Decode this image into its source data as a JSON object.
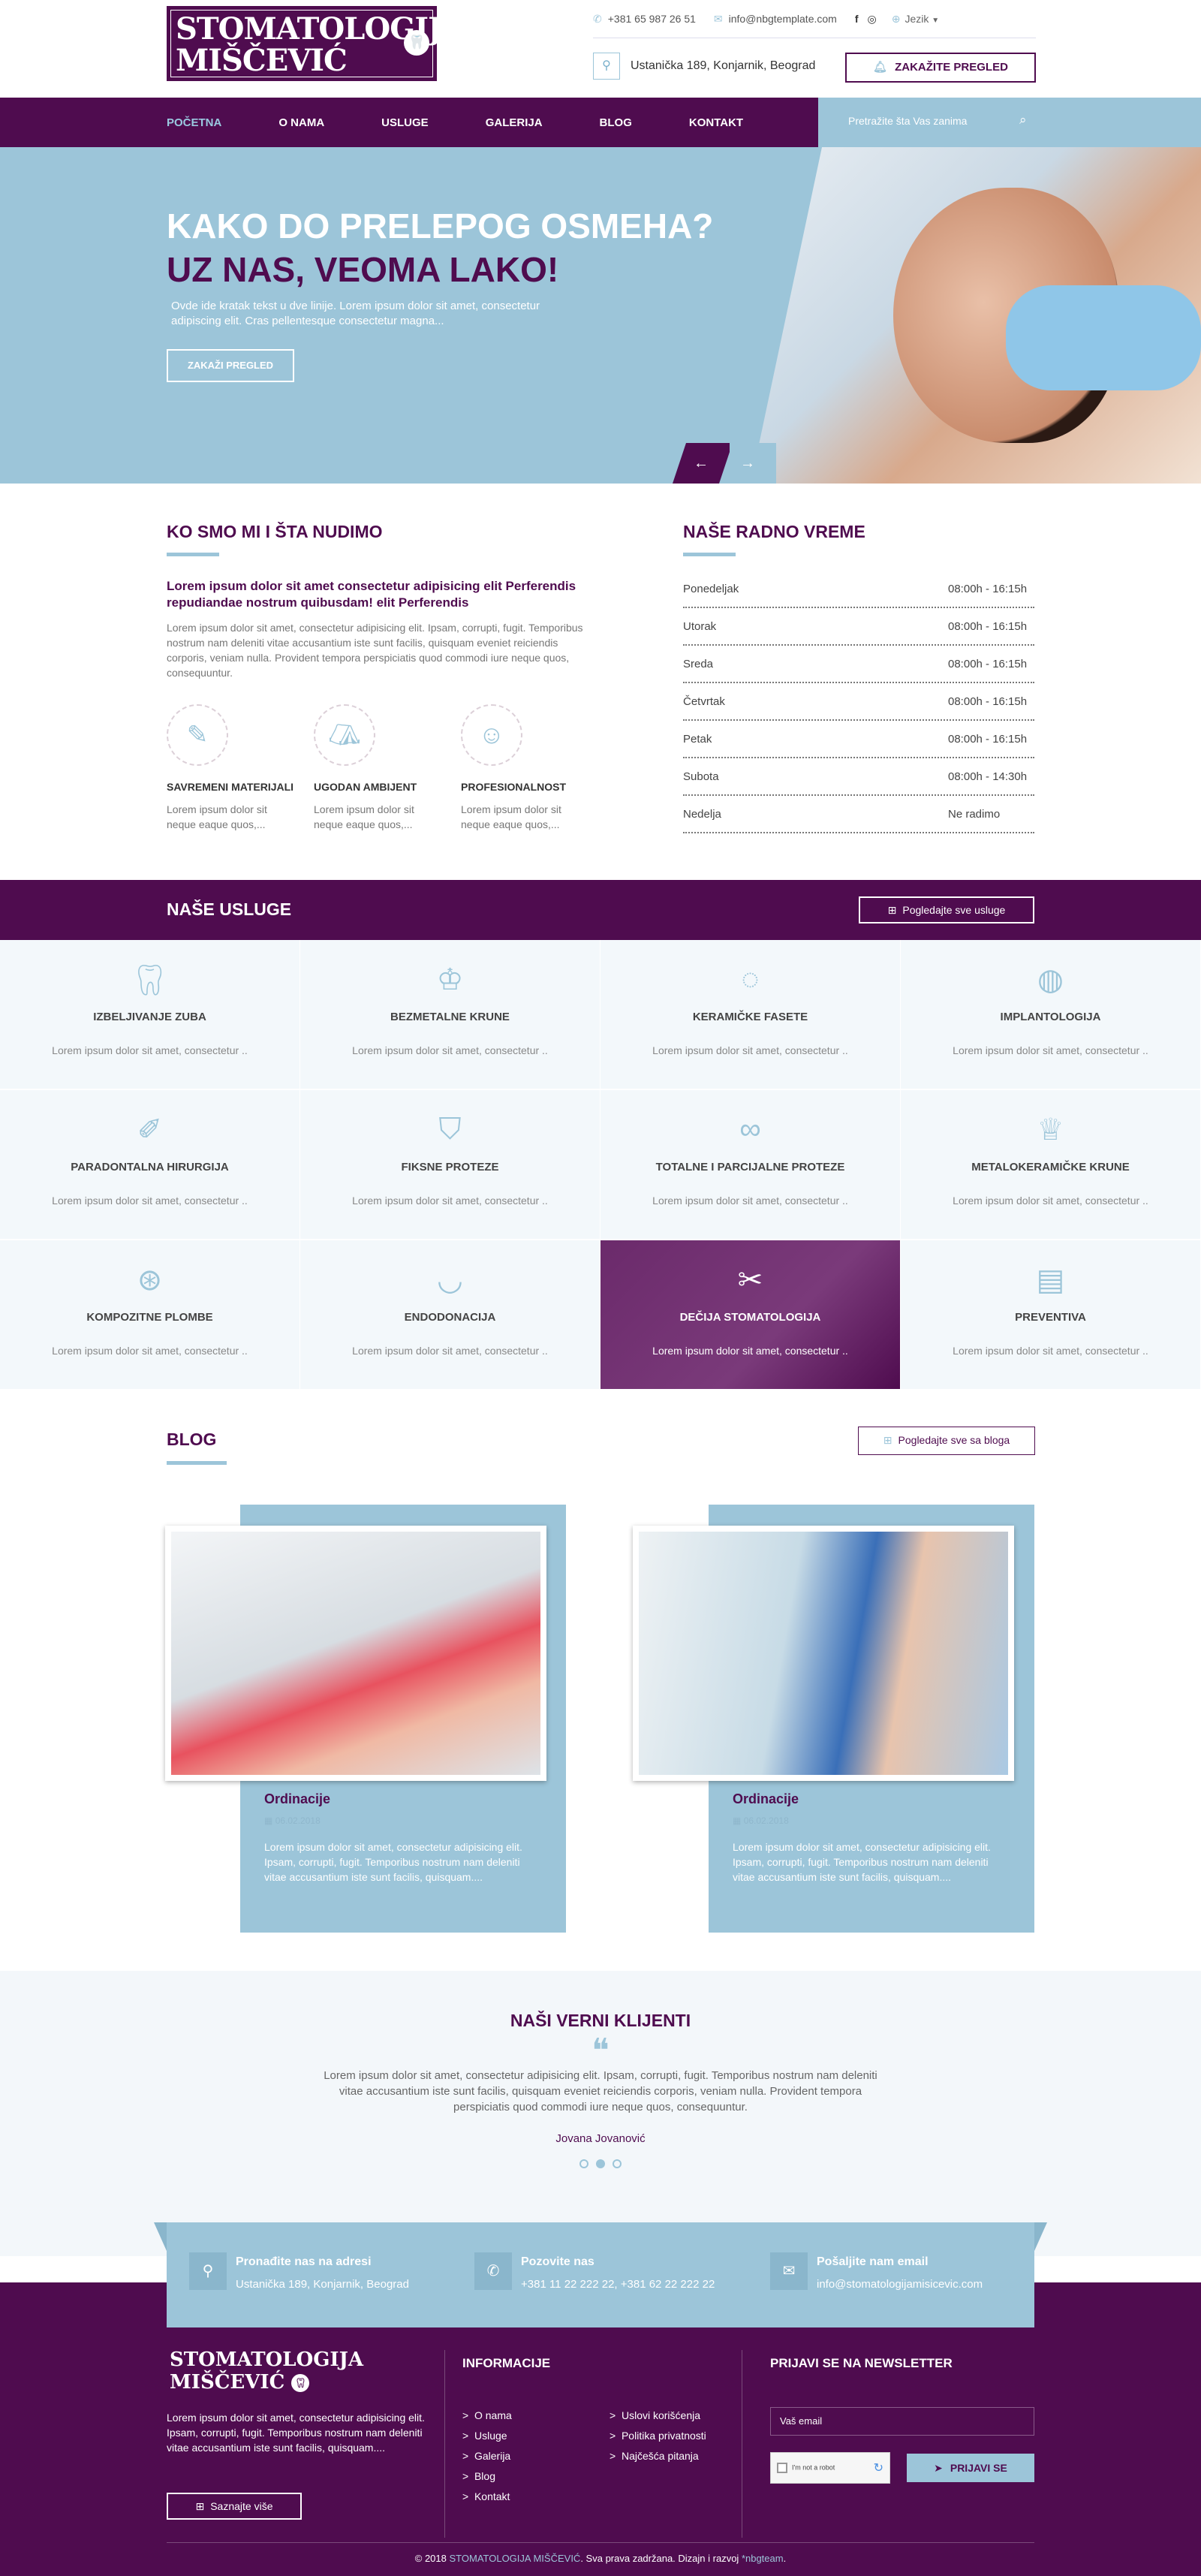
{
  "header": {
    "logo_line1": "STOMATOLOGIJA",
    "logo_line2": "MIŠČEVIĆ",
    "phone": "+381 65 987 26 51",
    "email": "info@nbgtemplate.com",
    "language": "Jezik",
    "address": "Ustanička 189, Konjarnik, Beograd",
    "appointment_button": "ZAKAŽITE PREGLED"
  },
  "nav": {
    "items": [
      "POČETNA",
      "O NAMA",
      "USLUGE",
      "GALERIJA",
      "BLOG",
      "KONTAKT"
    ],
    "search_placeholder": "Pretražite šta Vas zanima"
  },
  "hero": {
    "line1": "KAKO DO PRELEPOG OSMEHA?",
    "line2": "UZ NAS, VEOMA LAKO!",
    "text": "Ovde ide kratak tekst u dve linije. Lorem ipsum dolor sit amet, consectetur adipiscing elit. Cras pellentesque consectetur magna...",
    "button": "ZAKAŽI PREGLED"
  },
  "about": {
    "title": "KO SMO MI I ŠTA NUDIMO",
    "lead": "Lorem ipsum dolor sit amet consectetur adipisicing elit Perferendis repudiandae nostrum quibusdam! elit Perferendis",
    "text": "Lorem ipsum dolor sit amet, consectetur adipisicing elit. Ipsam, corrupti, fugit. Temporibus nostrum nam deleniti vitae accusantium iste sunt facilis, quisquam eveniet reiciendis corporis, veniam nulla. Provident tempora perspiciatis quod commodi iure neque quos, consequuntur.",
    "features": [
      {
        "icon": "instrument-icon",
        "title": "SAVREMENI MATERIJALI",
        "text": "Lorem ipsum dolor sit neque eaque quos,..."
      },
      {
        "icon": "dental-chair-icon",
        "title": "UGODAN AMBIJENT",
        "text": "Lorem ipsum dolor sit neque eaque quos,..."
      },
      {
        "icon": "dentist-icon",
        "title": "PROFESIONALNOST",
        "text": "Lorem ipsum dolor sit neque eaque quos,..."
      }
    ]
  },
  "hours": {
    "title": "NAŠE RADNO VREME",
    "rows": [
      {
        "day": "Ponedeljak",
        "time": "08:00h - 16:15h"
      },
      {
        "day": "Utorak",
        "time": "08:00h - 16:15h"
      },
      {
        "day": "Sreda",
        "time": "08:00h - 16:15h"
      },
      {
        "day": "Četvrtak",
        "time": "08:00h - 16:15h"
      },
      {
        "day": "Petak",
        "time": "08:00h - 16:15h"
      },
      {
        "day": "Subota",
        "time": "08:00h - 14:30h"
      },
      {
        "day": "Nedelja",
        "time": "Ne radimo"
      }
    ]
  },
  "services": {
    "title": "NAŠE USLUGE",
    "all_button": "Pogledajte sve usluge",
    "items": [
      {
        "title": "IZBELJIVANJE ZUBA",
        "text": "Lorem ipsum dolor sit amet, consectetur ..",
        "icon": "tooth-icon"
      },
      {
        "title": "BEZMETALNE KRUNE",
        "text": "Lorem ipsum dolor sit amet, consectetur ..",
        "icon": "crown-icon"
      },
      {
        "title": "KERAMIČKE FASETE",
        "text": "Lorem ipsum dolor sit amet, consectetur ..",
        "icon": "veneer-icon"
      },
      {
        "title": "IMPLANTOLOGIJA",
        "text": "Lorem ipsum dolor sit amet, consectetur ..",
        "icon": "implant-icon"
      },
      {
        "title": "PARADONTALNA HIRURGIJA",
        "text": "Lorem ipsum dolor sit amet, consectetur ..",
        "icon": "surgery-icon"
      },
      {
        "title": "FIKSNE PROTEZE",
        "text": "Lorem ipsum dolor sit amet, consectetur ..",
        "icon": "shield-tooth-icon"
      },
      {
        "title": "TOTALNE I PARCIJALNE PROTEZE",
        "text": "Lorem ipsum dolor sit amet, consectetur ..",
        "icon": "denture-icon"
      },
      {
        "title": "METALOKERAMIČKE KRUNE",
        "text": "Lorem ipsum dolor sit amet, consectetur ..",
        "icon": "crown-metal-icon"
      },
      {
        "title": "KOMPOZITNE PLOMBE",
        "text": "Lorem ipsum dolor sit amet, consectetur ..",
        "icon": "filling-icon"
      },
      {
        "title": "ENDODONACIJA",
        "text": "Lorem ipsum dolor sit amet, consectetur ..",
        "icon": "root-icon"
      },
      {
        "title": "DEČIJA STOMATOLOGIJA",
        "text": "Lorem ipsum dolor sit amet, consectetur ..",
        "icon": "tools-icon"
      },
      {
        "title": "PREVENTIVA",
        "text": "Lorem ipsum dolor sit amet, consectetur ..",
        "icon": "xray-icon"
      }
    ]
  },
  "blog": {
    "title": "BLOG",
    "all_button": "Pogledajte sve sa bloga",
    "posts": [
      {
        "title": "Ordinacije",
        "date": "06.02.2018",
        "text": "Lorem ipsum dolor sit amet, consectetur adipisicing elit. Ipsam, corrupti, fugit. Temporibus nostrum nam deleniti vitae accusantium iste sunt facilis, quisquam...."
      },
      {
        "title": "Ordinacije",
        "date": "06.02.2018",
        "text": "Lorem ipsum dolor sit amet, consectetur adipisicing elit. Ipsam, corrupti, fugit. Temporibus nostrum nam deleniti vitae accusantium iste sunt facilis, quisquam...."
      }
    ]
  },
  "testimonials": {
    "title": "NAŠI VERNI KLIJENTI",
    "quote": "Lorem ipsum dolor sit amet, consectetur adipisicing elit. Ipsam, corrupti, fugit. Temporibus nostrum nam deleniti vitae accusantium iste sunt facilis, quisquam eveniet reiciendis corporis, veniam nulla. Provident tempora perspiciatis quod commodi iure neque quos, consequuntur.",
    "author": "Jovana Jovanović"
  },
  "contact": [
    {
      "title": "Pronađite nas na adresi",
      "value": "Ustanička 189, Konjarnik, Beograd",
      "icon": "location-icon"
    },
    {
      "title": "Pozovite nas",
      "value": "+381 11 22 222 22, +381 62 22 222 22",
      "icon": "phone-icon"
    },
    {
      "title": "Pošaljite nam email",
      "value": "info@stomatologijamisicevic.com",
      "icon": "mail-icon"
    }
  ],
  "footer": {
    "about_text": "Lorem ipsum dolor sit amet, consectetur adipisicing elit. Ipsam, corrupti, fugit. Temporibus nostrum nam deleniti vitae accusantium iste sunt facilis, quisquam....",
    "more_button": "Saznajte više",
    "info_title": "INFORMACIJE",
    "links_col1": [
      "O nama",
      "Usluge",
      "Galerija",
      "Blog",
      "Kontakt"
    ],
    "links_col2": [
      "Uslovi korišćenja",
      "Politika privatnosti",
      "Najčešća pitanja"
    ],
    "newsletter_title": "PRIJAVI SE NA NEWSLETTER",
    "email_placeholder": "Vaš email",
    "captcha_label": "I'm not a robot",
    "subscribe_button": "PRIJAVI SE",
    "copyright_prefix": "© 2018 ",
    "copyright_brand": "STOMATOLOGIJA MIŠČEVIĆ",
    "copyright_mid": ". Sva prava zadržana. Dizajn i razvoj ",
    "copyright_dev": "*nbgteam",
    "copyright_end": "."
  },
  "colors": {
    "primary": "#4f0c4f",
    "accent": "#9cc5d9"
  }
}
